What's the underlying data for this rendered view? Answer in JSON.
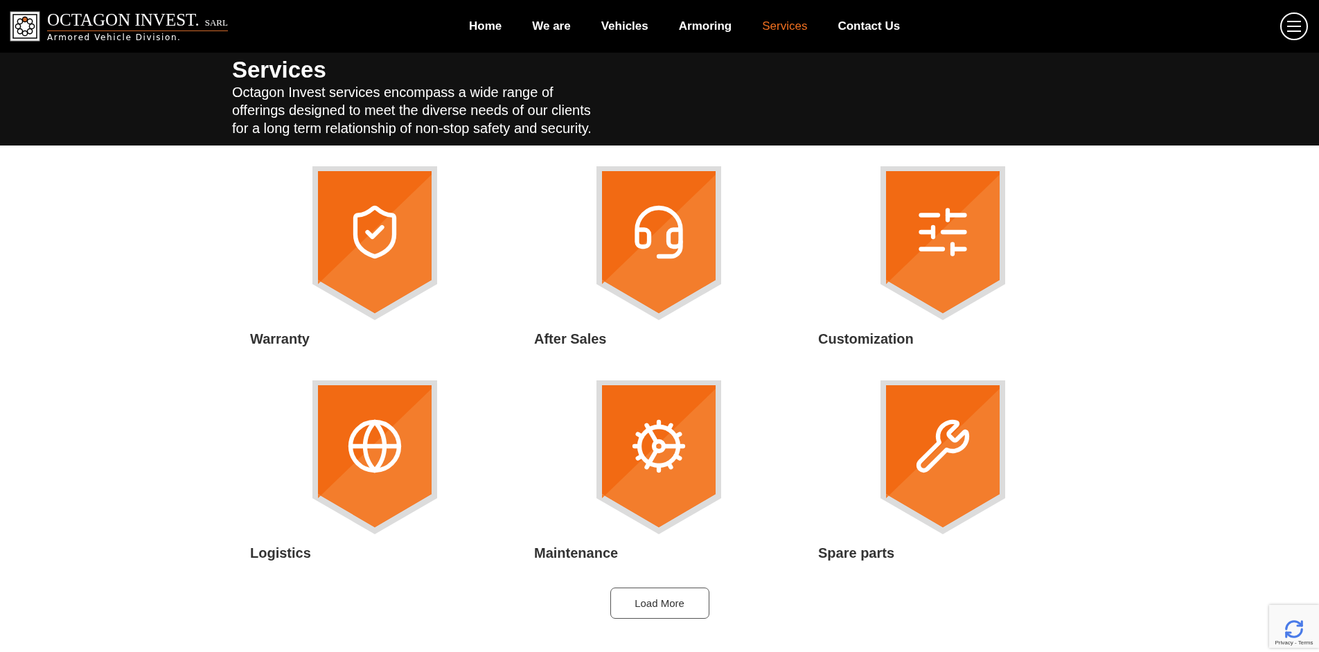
{
  "logo": {
    "name": "OCTAGON INVEST.",
    "suffix": "SARL",
    "tagline": "Armored Vehicle Division."
  },
  "nav": [
    {
      "label": "Home",
      "selected": false
    },
    {
      "label": "We are",
      "selected": false
    },
    {
      "label": "Vehicles",
      "selected": false
    },
    {
      "label": "Armoring",
      "selected": false
    },
    {
      "label": "Services",
      "selected": true
    },
    {
      "label": "Contact Us",
      "selected": false
    }
  ],
  "hero": {
    "title": "Services",
    "text": "Octagon Invest services encompass a wide range of offerings designed to meet the diverse needs of our clients for a long term relationship of non-stop safety and security."
  },
  "services": [
    {
      "title": "Warranty",
      "kind": "warranty"
    },
    {
      "title": "After Sales",
      "kind": "after_sales"
    },
    {
      "title": "Customization",
      "kind": "customization"
    },
    {
      "title": "Logistics",
      "kind": "logistics"
    },
    {
      "title": "Maintenance",
      "kind": "maintenance"
    },
    {
      "title": "Spare parts",
      "kind": "spare_parts"
    }
  ],
  "load_more": "Load More",
  "recaptcha": {
    "links": "Privacy - Terms"
  }
}
